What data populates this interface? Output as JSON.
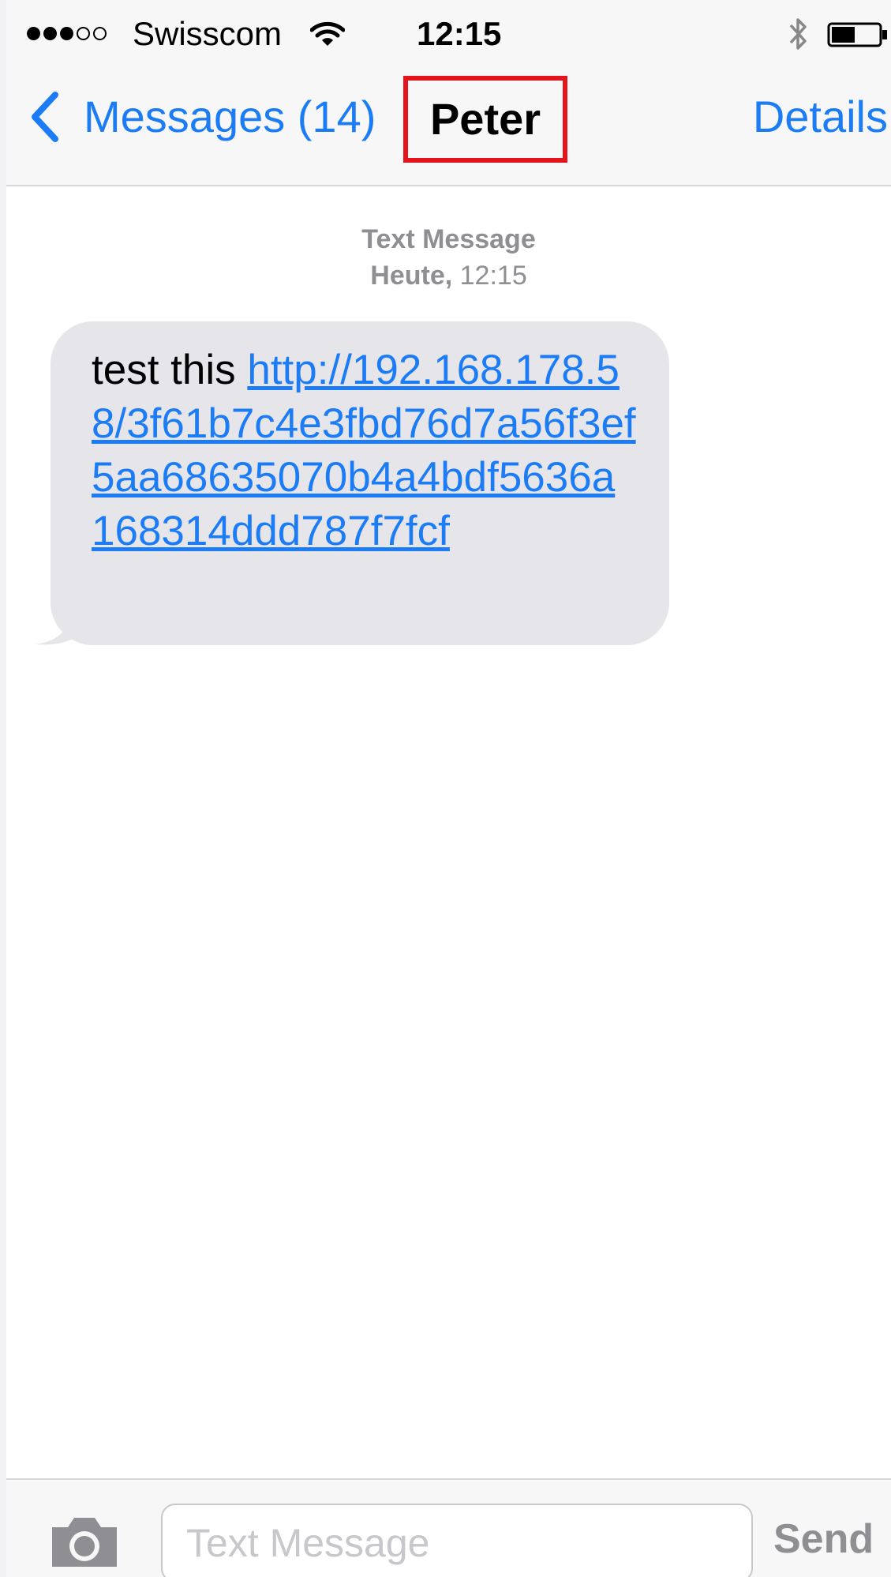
{
  "status_bar": {
    "signal_filled": 3,
    "signal_total": 5,
    "carrier": "Swisscom",
    "time": "12:15",
    "icons": [
      "wifi-icon",
      "bluetooth-icon",
      "battery-icon"
    ],
    "battery_level": 0.5
  },
  "nav": {
    "back_label": "Messages (14)",
    "contact_name": "Peter",
    "details_label": "Details",
    "highlight_color": "#e4141c"
  },
  "conversation": {
    "type_label": "Text Message",
    "day_label": "Heute,",
    "time_label": "12:15"
  },
  "message": {
    "text": "test this ",
    "link": "http://192.168.178.58/3f61b7c4e3fbd76d7a56f3ef5aa68635070b4a4bdf5636a168314ddd787f7fcf"
  },
  "composer": {
    "placeholder": "Text Message",
    "value": "",
    "send_label": "Send",
    "camera_icon": "camera-icon"
  },
  "colors": {
    "accent": "#1b7cf5",
    "bubble": "#e5e5ea",
    "meta_text": "#8e8e93"
  }
}
